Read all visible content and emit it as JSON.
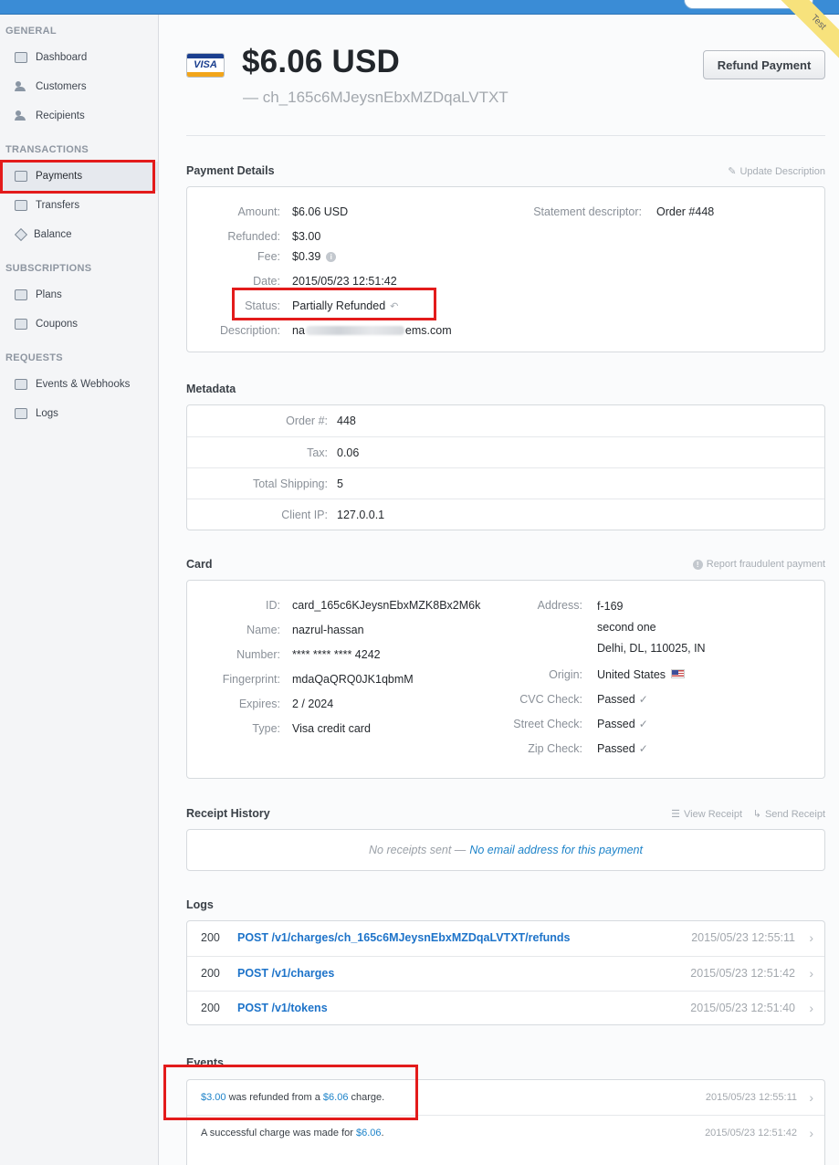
{
  "sidebar": {
    "general_title": "GENERAL",
    "transactions_title": "TRANSACTIONS",
    "subscriptions_title": "SUBSCRIPTIONS",
    "requests_title": "REQUESTS",
    "items": {
      "dashboard": "Dashboard",
      "customers": "Customers",
      "recipients": "Recipients",
      "payments": "Payments",
      "transfers": "Transfers",
      "balance": "Balance",
      "plans": "Plans",
      "coupons": "Coupons",
      "events": "Events & Webhooks",
      "logs": "Logs"
    }
  },
  "corner_badge": "Test",
  "header": {
    "card_brand": "VISA",
    "amount": "$6.06 USD",
    "charge_id": "— ch_165c6MJeysnEbxMZDqaLVTXT",
    "refund_button": "Refund Payment"
  },
  "payment_details": {
    "title": "Payment Details",
    "update_action": "Update Description",
    "amount_label": "Amount:",
    "amount_value": "$6.06 USD",
    "refunded_label": "Refunded:",
    "refunded_value": "$3.00",
    "fee_label": "Fee:",
    "fee_value": "$0.39",
    "date_label": "Date:",
    "date_value": "2015/05/23 12:51:42",
    "status_label": "Status:",
    "status_value": "Partially Refunded",
    "description_label": "Description:",
    "description_start": "na",
    "description_end": "ems.com",
    "statement_label": "Statement descriptor:",
    "statement_value": "Order #448"
  },
  "metadata": {
    "title": "Metadata",
    "rows": [
      {
        "key": "Order #:",
        "value": "448"
      },
      {
        "key": "Tax:",
        "value": "0.06"
      },
      {
        "key": "Total Shipping:",
        "value": "5"
      },
      {
        "key": "Client IP:",
        "value": "127.0.0.1"
      }
    ]
  },
  "card": {
    "title": "Card",
    "report_action": "Report fraudulent payment",
    "id_label": "ID:",
    "id_value": "card_165c6KJeysnEbxMZK8Bx2M6k",
    "name_label": "Name:",
    "name_value": "nazrul-hassan",
    "number_label": "Number:",
    "number_value": "**** **** **** 4242",
    "fingerprint_label": "Fingerprint:",
    "fingerprint_value": "mdaQaQRQ0JK1qbmM",
    "expires_label": "Expires:",
    "expires_value": "2 / 2024",
    "type_label": "Type:",
    "type_value": "Visa credit card",
    "address_label": "Address:",
    "address_line1": "f-169",
    "address_line2": "second one",
    "address_line3": "Delhi, DL, 110025, IN",
    "origin_label": "Origin:",
    "origin_value": "United States",
    "cvc_label": "CVC Check:",
    "cvc_value": "Passed",
    "street_label": "Street Check:",
    "street_value": "Passed",
    "zip_label": "Zip Check:",
    "zip_value": "Passed"
  },
  "receipt_history": {
    "title": "Receipt History",
    "view_action": "View Receipt",
    "send_action": "Send Receipt",
    "empty_text": "No receipts sent —",
    "empty_link": "No email address for this payment"
  },
  "logs": {
    "title": "Logs",
    "rows": [
      {
        "status": "200",
        "request": "POST /v1/charges/ch_165c6MJeysnEbxMZDqaLVTXT/refunds",
        "time": "2015/05/23 12:55:11"
      },
      {
        "status": "200",
        "request": "POST /v1/charges",
        "time": "2015/05/23 12:51:42"
      },
      {
        "status": "200",
        "request": "POST /v1/tokens",
        "time": "2015/05/23 12:51:40"
      }
    ]
  },
  "events": {
    "title": "Events",
    "rows": [
      {
        "amount": "$3.00",
        "middle": " was refunded from a ",
        "charge": "$6.06",
        "end": " charge.",
        "time": "2015/05/23 12:55:11"
      },
      {
        "prefix": "A successful charge was made for ",
        "charge": "$6.06",
        "end": ".",
        "time": "2015/05/23 12:51:42"
      }
    ]
  }
}
